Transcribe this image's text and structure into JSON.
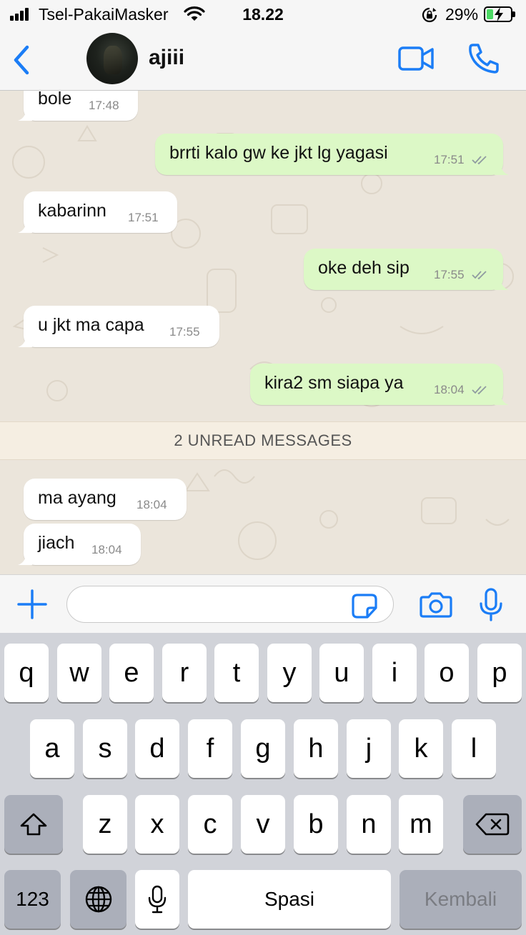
{
  "status_bar": {
    "carrier": "Tsel-PakaiMasker",
    "time": "18.22",
    "battery_percent": "29%",
    "battery_level": 0.29,
    "icons": [
      "signal-icon",
      "wifi-icon",
      "rotation-lock-icon",
      "battery-charging-icon"
    ]
  },
  "header": {
    "contact_name": "ajiii",
    "icons": [
      "back-icon",
      "video-call-icon",
      "phone-call-icon"
    ]
  },
  "messages": [
    {
      "direction": "in",
      "text": "bole",
      "time": "17:48"
    },
    {
      "direction": "out",
      "text": "brrti kalo gw ke jkt lg yagasi",
      "time": "17:51",
      "read": true
    },
    {
      "direction": "in",
      "text": "kabarinn",
      "time": "17:51"
    },
    {
      "direction": "out",
      "text": "oke deh sip",
      "time": "17:55",
      "read": true
    },
    {
      "direction": "in",
      "text": "u jkt ma capa",
      "time": "17:55"
    },
    {
      "direction": "out",
      "text": "kira2 sm siapa ya",
      "time": "18:04",
      "read": true
    },
    {
      "direction": "in",
      "text": "ma ayang",
      "time": "18:04"
    },
    {
      "direction": "in",
      "text": "jiach",
      "time": "18:04"
    }
  ],
  "unread_banner": "2 UNREAD MESSAGES",
  "input_bar": {
    "value": "",
    "icons": [
      "plus-icon",
      "sticker-icon",
      "camera-icon",
      "microphone-icon"
    ]
  },
  "keyboard": {
    "row1": [
      "q",
      "w",
      "e",
      "r",
      "t",
      "y",
      "u",
      "i",
      "o",
      "p"
    ],
    "row2": [
      "a",
      "s",
      "d",
      "f",
      "g",
      "h",
      "j",
      "k",
      "l"
    ],
    "row3": [
      "z",
      "x",
      "c",
      "v",
      "b",
      "n",
      "m"
    ],
    "numbers_key": "123",
    "space_key": "Spasi",
    "return_key": "Kembali",
    "icons": [
      "shift-icon",
      "backspace-icon",
      "globe-icon",
      "dictation-mic-icon"
    ]
  },
  "colors": {
    "accent": "#1b7df6",
    "outgoing_bubble": "#dcf8c6",
    "incoming_bubble": "#ffffff",
    "chat_background": "#ebe5db",
    "read_ticks": "#8f9aa0",
    "battery_fill": "#4cd964"
  }
}
